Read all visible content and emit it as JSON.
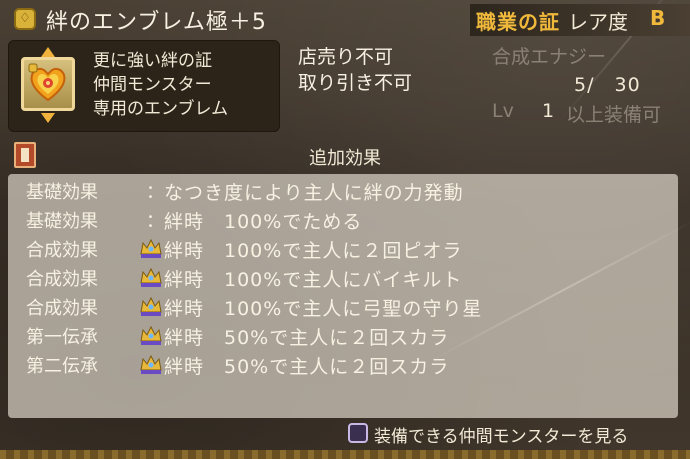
{
  "item": {
    "icon": "emblem-item-icon",
    "name": "絆のエンブレム極＋5",
    "certificate": "職業の証",
    "rarity_label": "レア度",
    "rarity_value": "B"
  },
  "description": {
    "lines": [
      "更に強い絆の証",
      "仲間モンスター",
      "専用のエンブレム"
    ]
  },
  "trade": {
    "lines": [
      "店売り不可",
      "取り引き不可"
    ]
  },
  "synthesis": {
    "label": "合成エナジー",
    "value": "5/　30"
  },
  "level": {
    "label": "Lv",
    "value": "1",
    "suffix": "以上装備可"
  },
  "effects": {
    "title": "追加効果",
    "rows": [
      {
        "type": "基礎効果",
        "sep": "：",
        "crown": false,
        "text": "なつき度により主人に絆の力発動"
      },
      {
        "type": "基礎効果",
        "sep": "：",
        "crown": false,
        "text": "絆時　100%でためる"
      },
      {
        "type": "合成効果",
        "sep": "",
        "crown": true,
        "text": "絆時　100%で主人に２回ピオラ"
      },
      {
        "type": "合成効果",
        "sep": "",
        "crown": true,
        "text": "絆時　100%で主人にバイキルト"
      },
      {
        "type": "合成効果",
        "sep": "",
        "crown": true,
        "text": "絆時　100%で主人に弓聖の守り星"
      },
      {
        "type": "第一伝承",
        "sep": "",
        "crown": true,
        "text": "絆時　50%で主人に２回スカラ"
      },
      {
        "type": "第二伝承",
        "sep": "",
        "crown": true,
        "text": "絆時　50%で主人に２回スカラ"
      }
    ]
  },
  "footer": {
    "button_icon": "square-button-icon",
    "action_label": "装備できる仲間モンスターを見る"
  },
  "colors": {
    "accent": "#f0b93b",
    "panel": "#2c2419",
    "list_bg": "#f3ecde"
  }
}
